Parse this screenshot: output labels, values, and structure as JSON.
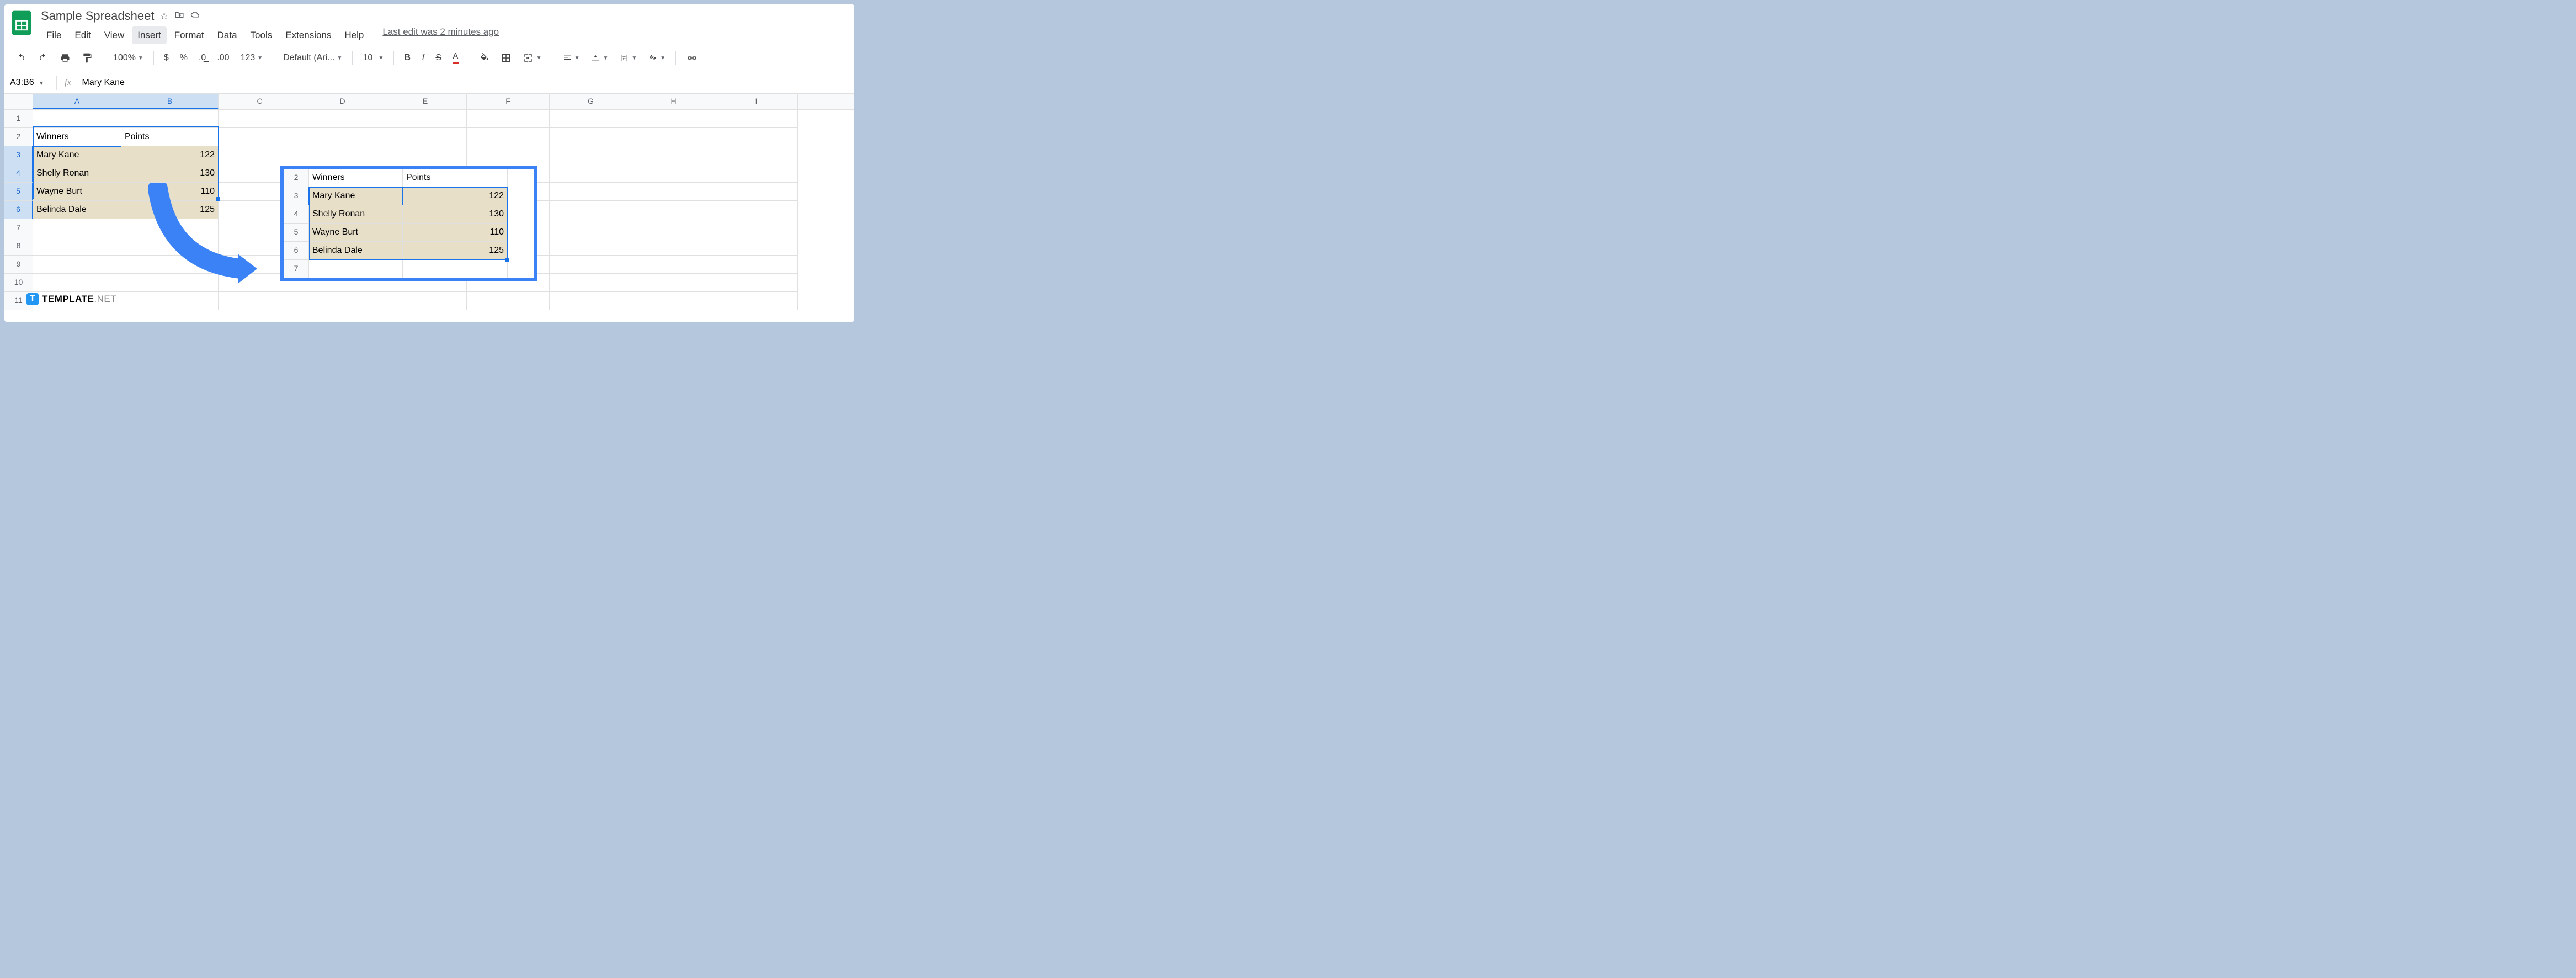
{
  "doc": {
    "title": "Sample Spreadsheet"
  },
  "menu": {
    "file": "File",
    "edit": "Edit",
    "view": "View",
    "insert": "Insert",
    "format": "Format",
    "data": "Data",
    "tools": "Tools",
    "extensions": "Extensions",
    "help": "Help",
    "last_edit": "Last edit was 2 minutes ago"
  },
  "toolbar": {
    "zoom": "100%",
    "dollar": "$",
    "percent": "%",
    "dec_minus": ".0",
    "dec_plus": ".00",
    "fmt123": "123",
    "font": "Default (Ari...",
    "size": "10",
    "bold": "B",
    "italic": "I",
    "strike": "S",
    "textcolor": "A"
  },
  "formula": {
    "cell_ref": "A3:B6",
    "fx": "fx",
    "content": "Mary Kane"
  },
  "cols": [
    "A",
    "B",
    "C",
    "D",
    "E",
    "F",
    "G",
    "H",
    "I"
  ],
  "rows": [
    "1",
    "2",
    "3",
    "4",
    "5",
    "6",
    "7",
    "8",
    "9",
    "10",
    "11"
  ],
  "cells": {
    "A2": "Winners",
    "B2": "Points",
    "A3": "Mary Kane",
    "B3": "122",
    "A4": "Shelly Ronan",
    "B4": "130",
    "A5": "Wayne Burt",
    "B5": "110",
    "A6": "Belinda Dale",
    "B6": "125"
  },
  "overlay": {
    "rows": [
      "2",
      "3",
      "4",
      "5",
      "6",
      "7"
    ],
    "headers": {
      "A": "Winners",
      "B": "Points"
    },
    "data": [
      {
        "r": "3",
        "name": "Mary Kane",
        "pts": "122"
      },
      {
        "r": "4",
        "name": "Shelly Ronan",
        "pts": "130"
      },
      {
        "r": "5",
        "name": "Wayne Burt",
        "pts": "110"
      },
      {
        "r": "6",
        "name": "Belinda Dale",
        "pts": "125"
      }
    ]
  },
  "watermark": {
    "icon": "T",
    "main": "TEMPLATE",
    "net": ".NET"
  }
}
